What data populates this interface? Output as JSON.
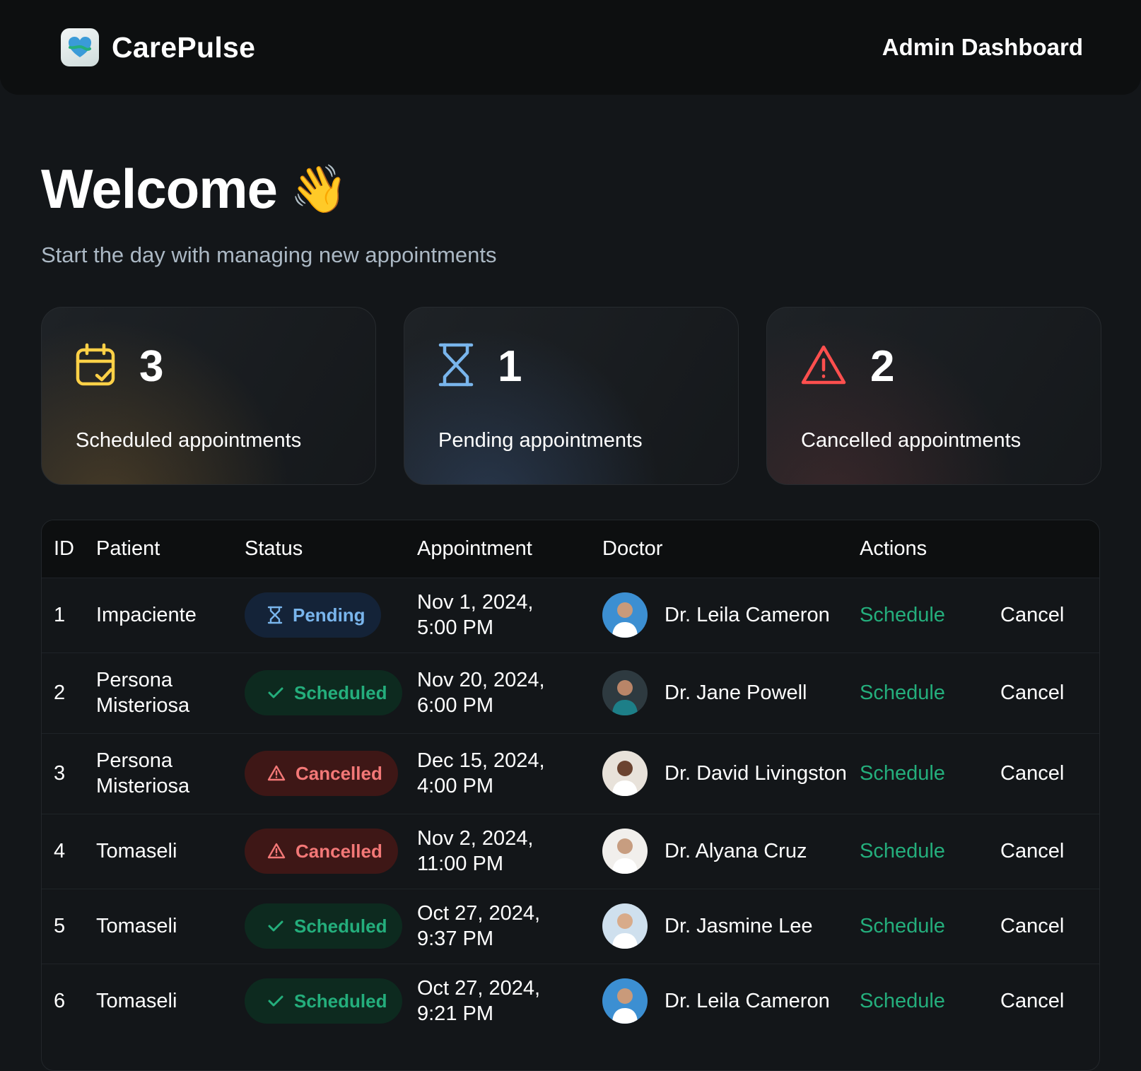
{
  "header": {
    "brand": "CarePulse",
    "title": "Admin Dashboard"
  },
  "welcome": {
    "title": "Welcome",
    "emoji": "👋",
    "subtitle": "Start the day with managing new appointments"
  },
  "stats": [
    {
      "count": "3",
      "label": "Scheduled appointments",
      "icon": "calendar-check-icon",
      "color": "#ffd147"
    },
    {
      "count": "1",
      "label": "Pending appointments",
      "icon": "hourglass-icon",
      "color": "#79b5ec"
    },
    {
      "count": "2",
      "label": "Cancelled appointments",
      "icon": "warning-icon",
      "color": "#ff4f4e"
    }
  ],
  "table": {
    "columns": [
      "ID",
      "Patient",
      "Status",
      "Appointment",
      "Doctor",
      "Actions"
    ],
    "rows": [
      {
        "id": "1",
        "patient": "Impaciente",
        "status": "Pending",
        "date": "Nov 1, 2024,",
        "time": "5:00 PM",
        "doctor": "Dr. Leila Cameron",
        "schedule": "Schedule",
        "cancel": "Cancel"
      },
      {
        "id": "2",
        "patient": "Persona Misteriosa",
        "status": "Scheduled",
        "date": "Nov 20, 2024,",
        "time": "6:00 PM",
        "doctor": "Dr. Jane Powell",
        "schedule": "Schedule",
        "cancel": "Cancel"
      },
      {
        "id": "3",
        "patient": "Persona Misteriosa",
        "status": "Cancelled",
        "date": "Dec 15, 2024,",
        "time": "4:00 PM",
        "doctor": "Dr. David Livingston",
        "schedule": "Schedule",
        "cancel": "Cancel"
      },
      {
        "id": "4",
        "patient": "Tomaseli",
        "status": "Cancelled",
        "date": "Nov 2, 2024,",
        "time": "11:00 PM",
        "doctor": "Dr. Alyana Cruz",
        "schedule": "Schedule",
        "cancel": "Cancel"
      },
      {
        "id": "5",
        "patient": "Tomaseli",
        "status": "Scheduled",
        "date": "Oct 27, 2024,",
        "time": "9:37 PM",
        "doctor": "Dr. Jasmine Lee",
        "schedule": "Schedule",
        "cancel": "Cancel"
      },
      {
        "id": "6",
        "patient": "Tomaseli",
        "status": "Scheduled",
        "date": "Oct 27, 2024,",
        "time": "9:21 PM",
        "doctor": "Dr. Leila Cameron",
        "schedule": "Schedule",
        "cancel": "Cancel"
      }
    ]
  },
  "colors": {
    "background": "#131619",
    "header": "#0d0f10",
    "green": "#24ae7c",
    "blue": "#79b5ec",
    "red": "#f37877",
    "yellow": "#ffd147"
  }
}
